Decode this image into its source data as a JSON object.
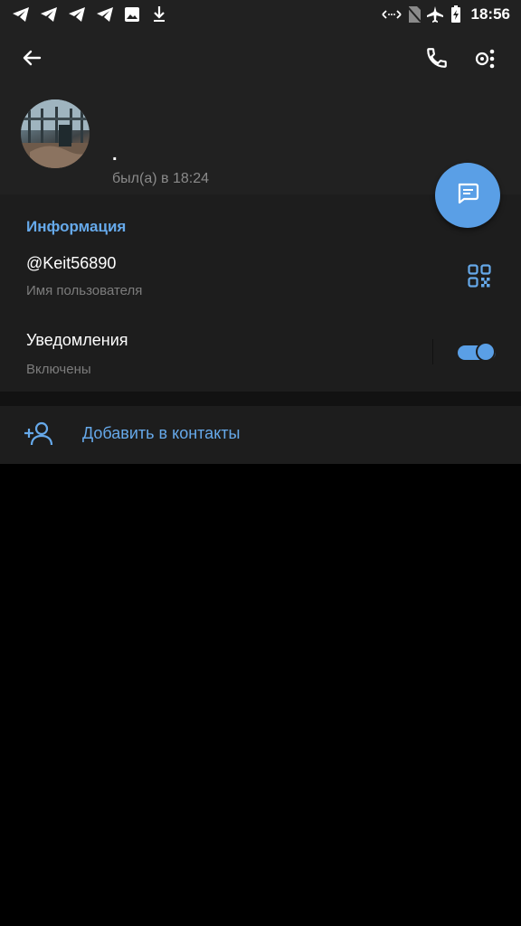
{
  "status_bar": {
    "time": "18:56",
    "icons": [
      "telegram-icon",
      "telegram-icon",
      "telegram-icon",
      "telegram-icon",
      "image-icon",
      "download-icon",
      "data-arrows-icon",
      "no-sim-icon",
      "airplane-icon",
      "battery-charging-icon"
    ]
  },
  "header": {
    "back_icon": "arrow-left-icon",
    "call_icon": "phone-icon",
    "more_icon": "more-menu-icon",
    "name": ".",
    "last_seen": "был(а) в 18:24",
    "fab_icon": "message-icon"
  },
  "info": {
    "section_title": "Информация",
    "username": "@Keit56890",
    "username_label": "Имя пользователя",
    "qr_icon": "qr-code-icon",
    "notifications_title": "Уведомления",
    "notifications_value": "Включены",
    "notifications_enabled": true
  },
  "actions": {
    "add_contact_icon": "add-user-icon",
    "add_contact_label": "Добавить в контакты"
  },
  "colors": {
    "accent": "#5a9fe6",
    "accent_text": "#66a9ea",
    "header_bg": "#212121",
    "section_bg": "#1d1d1d",
    "page_bg": "#000000"
  }
}
